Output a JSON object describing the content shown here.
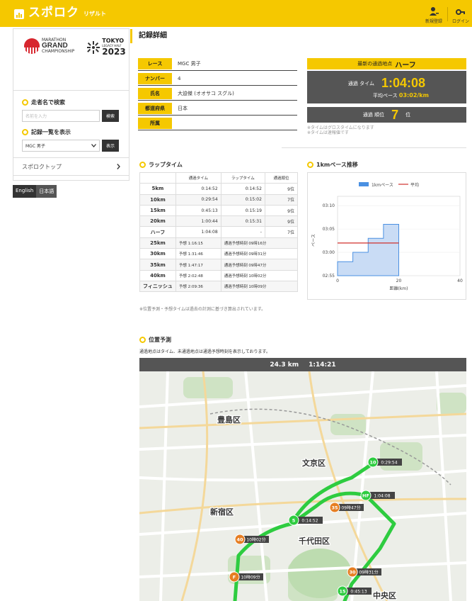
{
  "header": {
    "logo_main": "スポロク",
    "logo_sub": "リザルト",
    "btn_register": "新規登録",
    "btn_login": "ログイン"
  },
  "sidebar": {
    "mgc_top": "MARATHON",
    "mgc_mid": "GRAND",
    "mgc_bottom": "CHAMPIONSHIP",
    "tokyo_title": "TOKYO",
    "tokyo_sub": "LEGACY HALF",
    "tokyo_year": "2023",
    "search_heading": "走者名で検索",
    "search_placeholder": "名前を入力",
    "search_button": "検索",
    "list_heading": "記録一覧を表示",
    "list_selected": "MGC 男子",
    "list_button": "表示",
    "top_link": "スポロクトップ"
  },
  "lang": {
    "en": "English",
    "jp": "日本語"
  },
  "main": {
    "title": "記録詳細",
    "info": [
      {
        "label": "レース",
        "value": "MGC 男子"
      },
      {
        "label": "ナンバー",
        "value": "4"
      },
      {
        "label": "氏名",
        "value": "大迫傑 (オオサコ スグル)"
      },
      {
        "label": "都道府県",
        "value": "日本"
      },
      {
        "label": "所属",
        "value": ""
      }
    ],
    "latest": {
      "head_prefix": "最新の通過地点",
      "head_point": "ハーフ",
      "time_label": "通過 タイム",
      "time_value": "1:04:08",
      "pace_label": "平均ペース",
      "pace_value": "03:02/km",
      "rank_label": "通過 順位",
      "rank_value": "7",
      "rank_suffix": "位",
      "note1": "※タイムはグロスタイムになります",
      "note2": "※タイムは速報値です"
    },
    "lap_heading": "ラップタイム",
    "lap_headers": [
      "",
      "通過タイム",
      "ラップタイム",
      "通過順位"
    ],
    "laps": [
      {
        "point": "5km",
        "pass": "0:14:52",
        "lap": "0:14:52",
        "rank": "9位"
      },
      {
        "point": "10km",
        "pass": "0:29:54",
        "lap": "0:15:02",
        "rank": "7位"
      },
      {
        "point": "15km",
        "pass": "0:45:13",
        "lap": "0:15:19",
        "rank": "9位"
      },
      {
        "point": "20km",
        "pass": "1:00:44",
        "lap": "0:15:31",
        "rank": "9位"
      },
      {
        "point": "ハーフ",
        "pass": "1:04:08",
        "lap": "-",
        "rank": "7位"
      },
      {
        "point": "25km",
        "pass": "予想 1:16:15",
        "lap": "通過予想時刻 09時16分",
        "rank": ""
      },
      {
        "point": "30km",
        "pass": "予想 1:31:46",
        "lap": "通過予想時刻 09時31分",
        "rank": ""
      },
      {
        "point": "35km",
        "pass": "予想 1:47:17",
        "lap": "通過予想時刻 09時47分",
        "rank": ""
      },
      {
        "point": "40km",
        "pass": "予想 2:02:48",
        "lap": "通過予想時刻 10時02分",
        "rank": ""
      },
      {
        "point": "フィニッシュ",
        "pass": "予想 2:09:36",
        "lap": "通過予想時刻 10時09分",
        "rank": ""
      }
    ],
    "lap_note": "※位置予測・予想タイムは過去の計測に基づき算出されています。",
    "pace_heading": "1kmペース推移",
    "predict_heading": "位置予測",
    "predict_note": "通過地点はタイム、未通過地点は通過予想時刻を表示しております。",
    "map_km": "24.3 km",
    "map_time": "1:14:21"
  },
  "chart_data": {
    "type": "area",
    "title": "",
    "xlabel": "距離(km)",
    "ylabel": "ペース",
    "x": [
      0,
      5,
      10,
      15,
      20
    ],
    "xlim": [
      0,
      40
    ],
    "xticks": [
      0,
      20,
      40
    ],
    "yticks": [
      "02:55",
      "03:00",
      "03:05",
      "03:10"
    ],
    "ylim_seconds": [
      175,
      192
    ],
    "series": [
      {
        "name": "1kmペース",
        "type": "step-area",
        "color": "#4a90e2",
        "values": [
          "02:58",
          "03:00",
          "03:03",
          "03:06"
        ]
      },
      {
        "name": "平均",
        "type": "line",
        "color": "#d0312d",
        "value": "03:02",
        "range": [
          0,
          20
        ]
      }
    ],
    "legend": "top"
  },
  "map": {
    "wards": [
      "豊島区",
      "文京区",
      "新宿区",
      "千代田区",
      "中央区"
    ],
    "markers": [
      {
        "num": "5",
        "label": "0:14:52",
        "type": "passed"
      },
      {
        "num": "10",
        "label": "0:29:54",
        "type": "passed"
      },
      {
        "num": "HF",
        "label": "1:04:08",
        "type": "passed"
      },
      {
        "num": "15",
        "label": "0:45:13",
        "type": "passed"
      },
      {
        "num": "35",
        "label": "09時47分",
        "type": "predicted"
      },
      {
        "num": "40",
        "label": "10時02分",
        "type": "predicted"
      },
      {
        "num": "30",
        "label": "09時31分",
        "type": "predicted"
      },
      {
        "num": "F",
        "label": "10時09分",
        "type": "predicted"
      }
    ]
  }
}
